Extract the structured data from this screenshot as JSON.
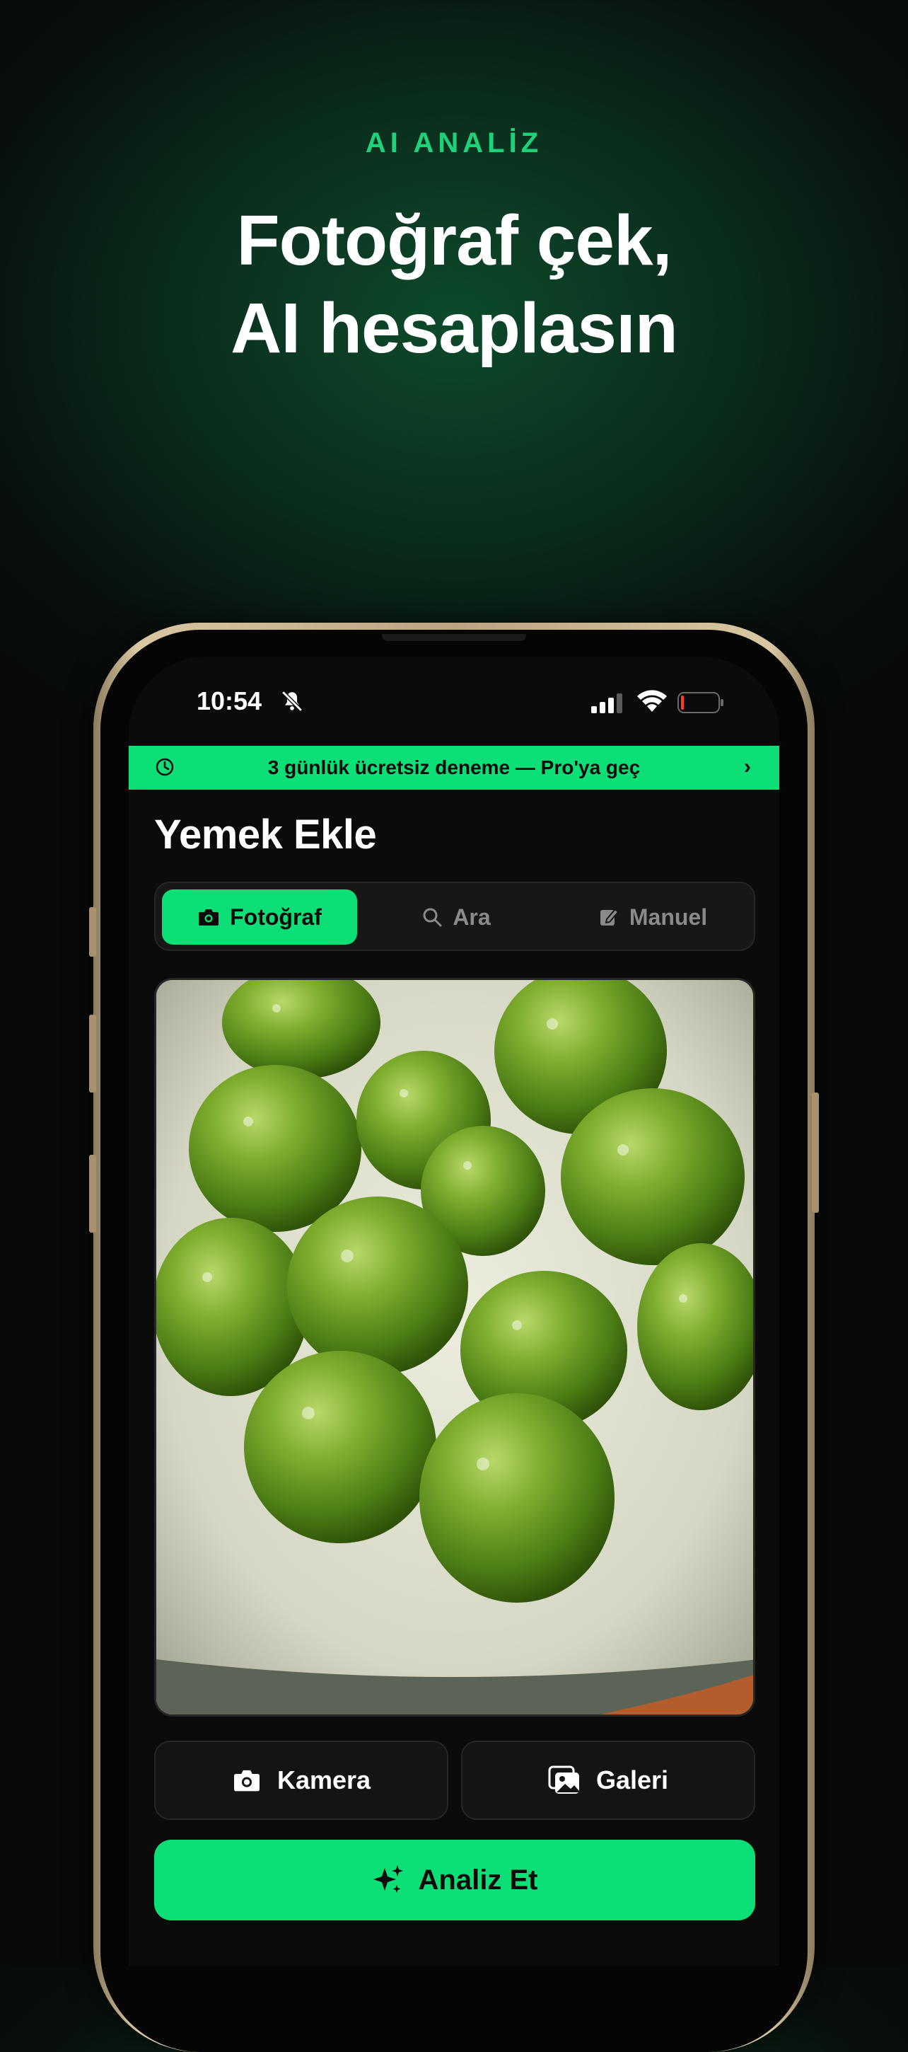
{
  "hero": {
    "eyebrow": "AI ANALİZ",
    "headline_line1": "Fotoğraf çek,",
    "headline_line2": "AI hesaplasın"
  },
  "status_bar": {
    "time": "10:54",
    "icons": [
      "bell-slash-icon",
      "signal-icon",
      "wifi-icon",
      "battery-icon"
    ]
  },
  "promo_banner": {
    "text": "3 günlük ücretsiz deneme — Pro'ya geç",
    "icon": "clock-icon",
    "chevron": "›"
  },
  "page": {
    "title": "Yemek Ekle"
  },
  "tabs": [
    {
      "label": "Fotoğraf",
      "icon": "camera-icon",
      "active": true
    },
    {
      "label": "Ara",
      "icon": "search-icon",
      "active": false
    },
    {
      "label": "Manuel",
      "icon": "edit-icon",
      "active": false
    }
  ],
  "actions": {
    "camera_label": "Kamera",
    "gallery_label": "Galeri",
    "analyze_label": "Analiz Et"
  },
  "colors": {
    "accent": "#0ddf77",
    "eyebrow": "#1ed27a",
    "background": "#0b0b0b",
    "surface": "#171717"
  }
}
